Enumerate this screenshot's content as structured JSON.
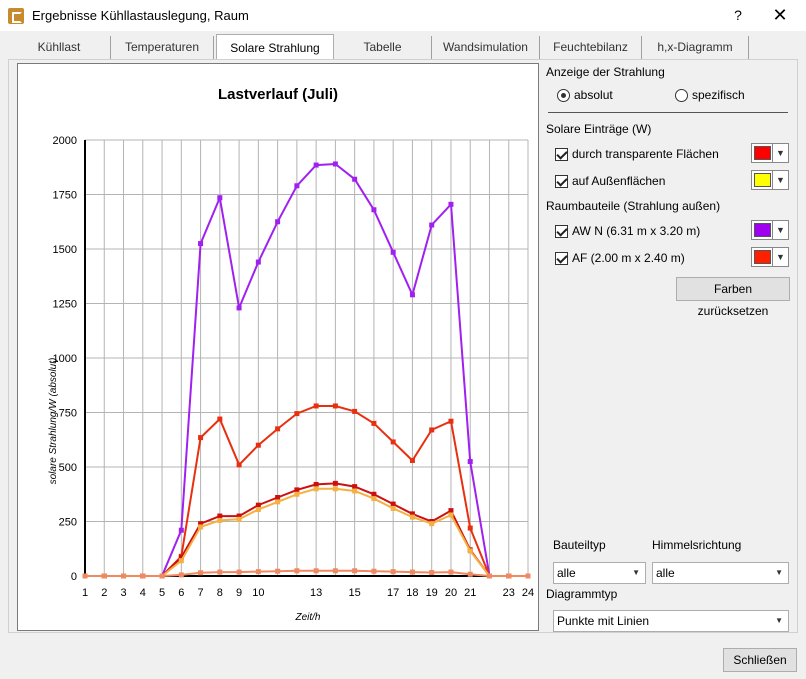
{
  "window": {
    "title": "Ergebnisse Kühllastauslegung, Raum",
    "help": "?",
    "close": "✕"
  },
  "tabs": [
    {
      "label": "Kühllast"
    },
    {
      "label": "Temperaturen"
    },
    {
      "label": "Solare Strahlung"
    },
    {
      "label": "Tabelle"
    },
    {
      "label": "Wandsimulation"
    },
    {
      "label": "Feuchtebilanz"
    },
    {
      "label": "h,x-Diagramm"
    }
  ],
  "right_panel": {
    "display_group": "Anzeige der Strahlung",
    "radio_absolute": "absolut",
    "radio_specific": "spezifisch",
    "solar_group": "Solare Einträge (W)",
    "transparent": "durch transparente Flächen",
    "outer": "auf Außenflächen",
    "components_group": "Raumbauteile (Strahlung außen)",
    "aw_n": "AW N (6.31 m x 3.20 m)",
    "af": "AF (2.00 m x 2.40 m)",
    "reset_colors": "Farben zurücksetzen",
    "component_type_label": "Bauteiltyp",
    "component_type_value": "alle",
    "orientation_label": "Himmelsrichtung",
    "orientation_value": "alle",
    "chart_type_label": "Diagrammtyp",
    "chart_type_value": "Punkte mit Linien"
  },
  "colors": {
    "transparent": "#ff0000",
    "outer": "#ffff00",
    "aw_n": "#a000f0",
    "af": "#ff2000"
  },
  "footer": {
    "close_button": "Schließen"
  },
  "chart_data": {
    "type": "line",
    "title": "Lastverlauf (Juli)",
    "xlabel": "Zeit/h",
    "ylabel": "solare Strahlung/W (absolut)",
    "xlim": [
      1,
      24
    ],
    "ylim": [
      0,
      2000
    ],
    "x_ticks": [
      1,
      2,
      3,
      4,
      5,
      6,
      7,
      8,
      9,
      10,
      11,
      12,
      13,
      14,
      15,
      16,
      17,
      18,
      19,
      20,
      21,
      22,
      23,
      24
    ],
    "x_tick_labels": [
      "1",
      "2",
      "3",
      "4",
      "5",
      "6",
      "7",
      "8",
      "9",
      "10",
      "",
      "",
      "13",
      "",
      "15",
      "",
      "17",
      "18",
      "19",
      "20",
      "21",
      "",
      "23",
      "24"
    ],
    "y_ticks": [
      0,
      250,
      500,
      750,
      1000,
      1250,
      1500,
      1750,
      2000
    ],
    "grid": true,
    "x": [
      1,
      2,
      3,
      4,
      5,
      6,
      7,
      8,
      9,
      10,
      11,
      12,
      13,
      14,
      15,
      16,
      17,
      18,
      19,
      20,
      21,
      22,
      23,
      24
    ],
    "series": [
      {
        "color": "#a020f0",
        "values": [
          0,
          0,
          0,
          0,
          0,
          210,
          1525,
          1735,
          1230,
          1440,
          1625,
          1790,
          1885,
          1890,
          1820,
          1680,
          1485,
          1290,
          1610,
          1705,
          525,
          0,
          0,
          0
        ]
      },
      {
        "color": "#e83010",
        "values": [
          0,
          0,
          0,
          0,
          0,
          90,
          635,
          720,
          510,
          600,
          675,
          745,
          780,
          780,
          755,
          700,
          615,
          530,
          670,
          710,
          220,
          0,
          0,
          0
        ]
      },
      {
        "color": "#cc1010",
        "values": [
          0,
          0,
          0,
          0,
          0,
          85,
          240,
          275,
          275,
          325,
          360,
          395,
          420,
          425,
          410,
          375,
          330,
          285,
          250,
          300,
          120,
          0,
          0,
          0
        ]
      },
      {
        "color": "#f4b040",
        "values": [
          0,
          0,
          0,
          0,
          0,
          70,
          225,
          255,
          260,
          305,
          340,
          375,
          400,
          400,
          390,
          355,
          310,
          270,
          240,
          280,
          115,
          0,
          0,
          0
        ]
      },
      {
        "color": "#f08860",
        "values": [
          0,
          0,
          0,
          0,
          0,
          5,
          15,
          18,
          18,
          20,
          22,
          24,
          24,
          24,
          24,
          22,
          20,
          18,
          16,
          18,
          8,
          0,
          0,
          0
        ]
      }
    ]
  }
}
